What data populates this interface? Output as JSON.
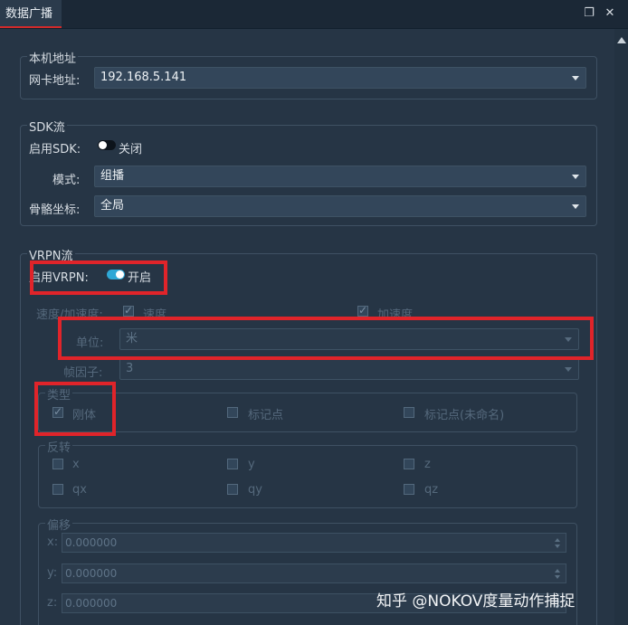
{
  "window": {
    "tab_title": "数据广播"
  },
  "local": {
    "title": "本机地址",
    "nic_label": "网卡地址:",
    "nic_value": "192.168.5.141"
  },
  "sdk": {
    "title": "SDK流",
    "enable_label": "启用SDK:",
    "enable_state": "关闭",
    "enabled": false,
    "mode_label": "模式:",
    "mode_value": "组播",
    "coord_label": "骨骼坐标:",
    "coord_value": "全局"
  },
  "vrpn": {
    "title": "VRPN流",
    "enable_label": "启用VRPN:",
    "enable_state": "开启",
    "enabled": true,
    "speed_label": "速度/加速度:",
    "velocity_label": "速度",
    "velocity_checked": true,
    "accel_label": "加速度",
    "accel_checked": true,
    "unit_label": "单位:",
    "unit_value": "米",
    "frame_label": "帧因子:",
    "frame_value": "3"
  },
  "type_group": {
    "title": "类型",
    "items": [
      {
        "label": "刚体",
        "checked": true
      },
      {
        "label": "标记点",
        "checked": false
      },
      {
        "label": "标记点(未命名)",
        "checked": false
      }
    ]
  },
  "flip_group": {
    "title": "反转",
    "items": [
      {
        "label": "x",
        "checked": false
      },
      {
        "label": "y",
        "checked": false
      },
      {
        "label": "z",
        "checked": false
      },
      {
        "label": "qx",
        "checked": false
      },
      {
        "label": "qy",
        "checked": false
      },
      {
        "label": "qz",
        "checked": false
      }
    ]
  },
  "offset_group": {
    "title": "偏移",
    "x_label": "x:",
    "x_value": "0.000000",
    "y_label": "y:",
    "y_value": "0.000000",
    "z_label": "z:",
    "z_value": "0.000000"
  },
  "watermark": "知乎 @NOKOV度量动作捕捉",
  "colors": {
    "toggle_on": "#2ea8d6",
    "toggle_off": "#0d141b",
    "highlight_red": "#e0242a"
  },
  "icons": {
    "restore": "restore-window-icon",
    "close": "close-icon"
  }
}
